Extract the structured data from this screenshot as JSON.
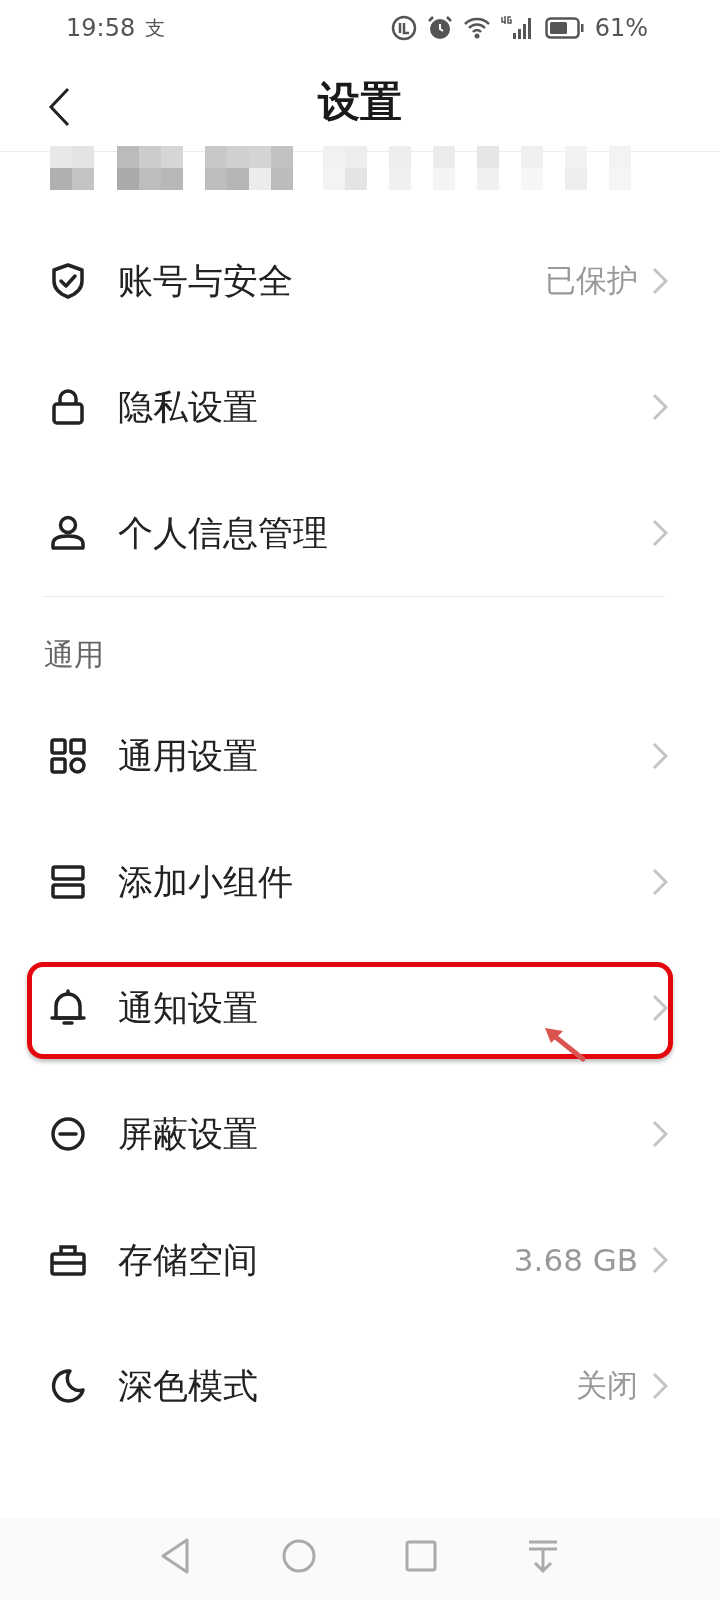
{
  "status_bar": {
    "time": "19:58",
    "app_glyph": "支",
    "battery": "61%"
  },
  "header": {
    "title": "设置"
  },
  "profile": {
    "redacted": true
  },
  "sections": [
    {
      "items": [
        {
          "kind": "shield",
          "label": "账号与安全",
          "value": "已保护",
          "highlighted": false
        },
        {
          "kind": "lock",
          "label": "隐私设置",
          "highlighted": false
        },
        {
          "kind": "person",
          "label": "个人信息管理",
          "highlighted": false
        }
      ]
    },
    {
      "title": "通用",
      "items": [
        {
          "kind": "grid",
          "label": "通用设置",
          "highlighted": false
        },
        {
          "kind": "widget",
          "label": "添加小组件",
          "highlighted": false
        },
        {
          "kind": "bell",
          "label": "通知设置",
          "highlighted": true
        },
        {
          "kind": "block",
          "label": "屏蔽设置",
          "highlighted": false
        },
        {
          "kind": "storage",
          "label": "存储空间",
          "value": "3.68 GB",
          "highlighted": false
        },
        {
          "kind": "moon",
          "label": "深色模式",
          "value": "关闭",
          "highlighted": false
        }
      ]
    }
  ]
}
